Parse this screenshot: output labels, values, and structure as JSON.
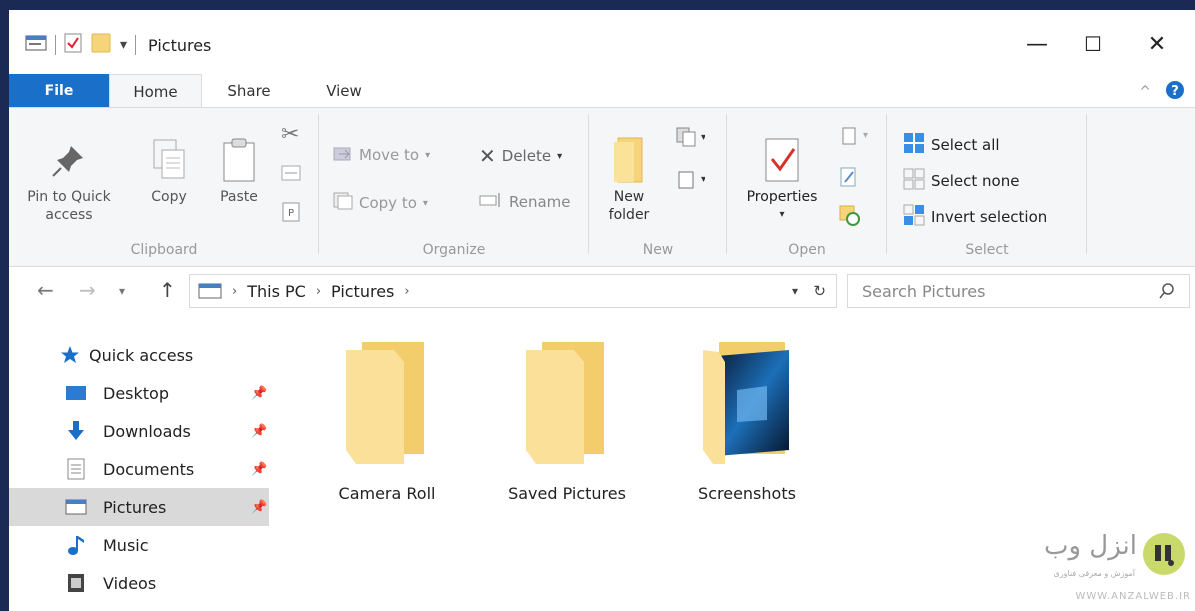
{
  "window": {
    "title": "Pictures",
    "controls": {
      "minimize": "—",
      "maximize": "☐",
      "close": "✕"
    }
  },
  "ribbon_tabs": {
    "file": "File",
    "home": "Home",
    "share": "Share",
    "view": "View"
  },
  "clipboard": {
    "pin_label_1": "Pin to Quick",
    "pin_label_2": "access",
    "copy": "Copy",
    "paste": "Paste",
    "group": "Clipboard"
  },
  "organize": {
    "move_to": "Move to",
    "copy_to": "Copy to",
    "delete": "Delete",
    "rename": "Rename",
    "group": "Organize"
  },
  "new_group": {
    "new_folder_1": "New",
    "new_folder_2": "folder",
    "group": "New"
  },
  "open_group": {
    "properties": "Properties",
    "group": "Open"
  },
  "select_group": {
    "select_all": "Select all",
    "select_none": "Select none",
    "invert": "Invert selection",
    "group": "Select"
  },
  "address": {
    "crumbs": [
      "This PC",
      "Pictures"
    ],
    "search_placeholder": "Search Pictures"
  },
  "nav_pane": {
    "items": [
      {
        "label": "Quick access"
      },
      {
        "label": "Desktop"
      },
      {
        "label": "Downloads"
      },
      {
        "label": "Documents"
      },
      {
        "label": "Pictures"
      },
      {
        "label": "Music"
      },
      {
        "label": "Videos"
      }
    ]
  },
  "folders": [
    {
      "name": "Camera Roll"
    },
    {
      "name": "Saved Pictures"
    },
    {
      "name": "Screenshots"
    }
  ],
  "watermark": {
    "brand": "انزل وب",
    "tagline": "آموزش و معرفی فناوری",
    "url": "WWW.ANZALWEB.IR"
  }
}
